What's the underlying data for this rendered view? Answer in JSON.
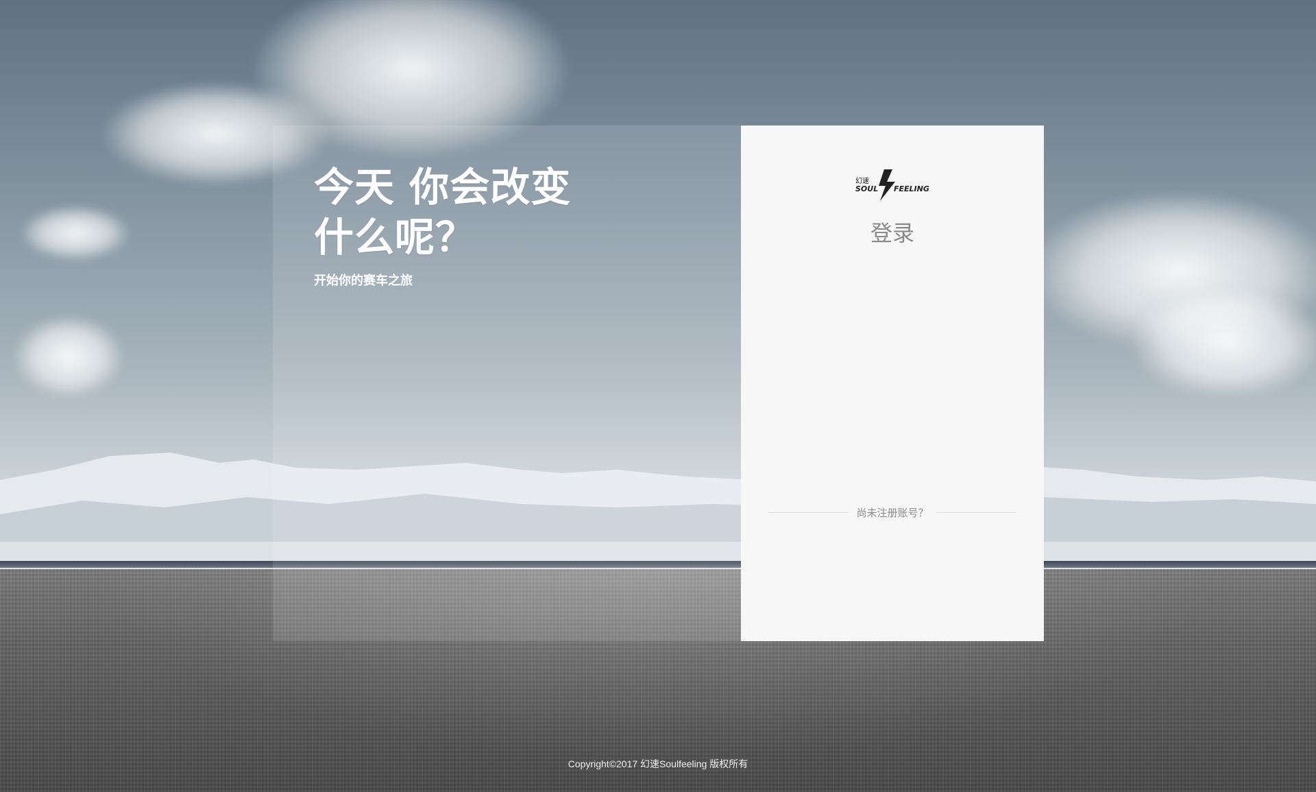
{
  "hero": {
    "headline_line1": "今天 你会改变",
    "headline_line2": "什么呢？",
    "subtitle": "开始你的赛车之旅"
  },
  "login_panel": {
    "logo_icon": "soulfeeling-logo",
    "logo_cn": "幻速",
    "logo_en_left": "SOUL",
    "logo_en_right": "FEELING",
    "title": "登录",
    "register_prompt": "尚未注册账号？"
  },
  "footer": {
    "copyright": "Copyright©2017 幻速Soulfeeling 版权所有"
  },
  "colors": {
    "panel_bg": "#f7f7f7",
    "title_gray": "#8a8a8a",
    "text_white": "#ffffff"
  }
}
